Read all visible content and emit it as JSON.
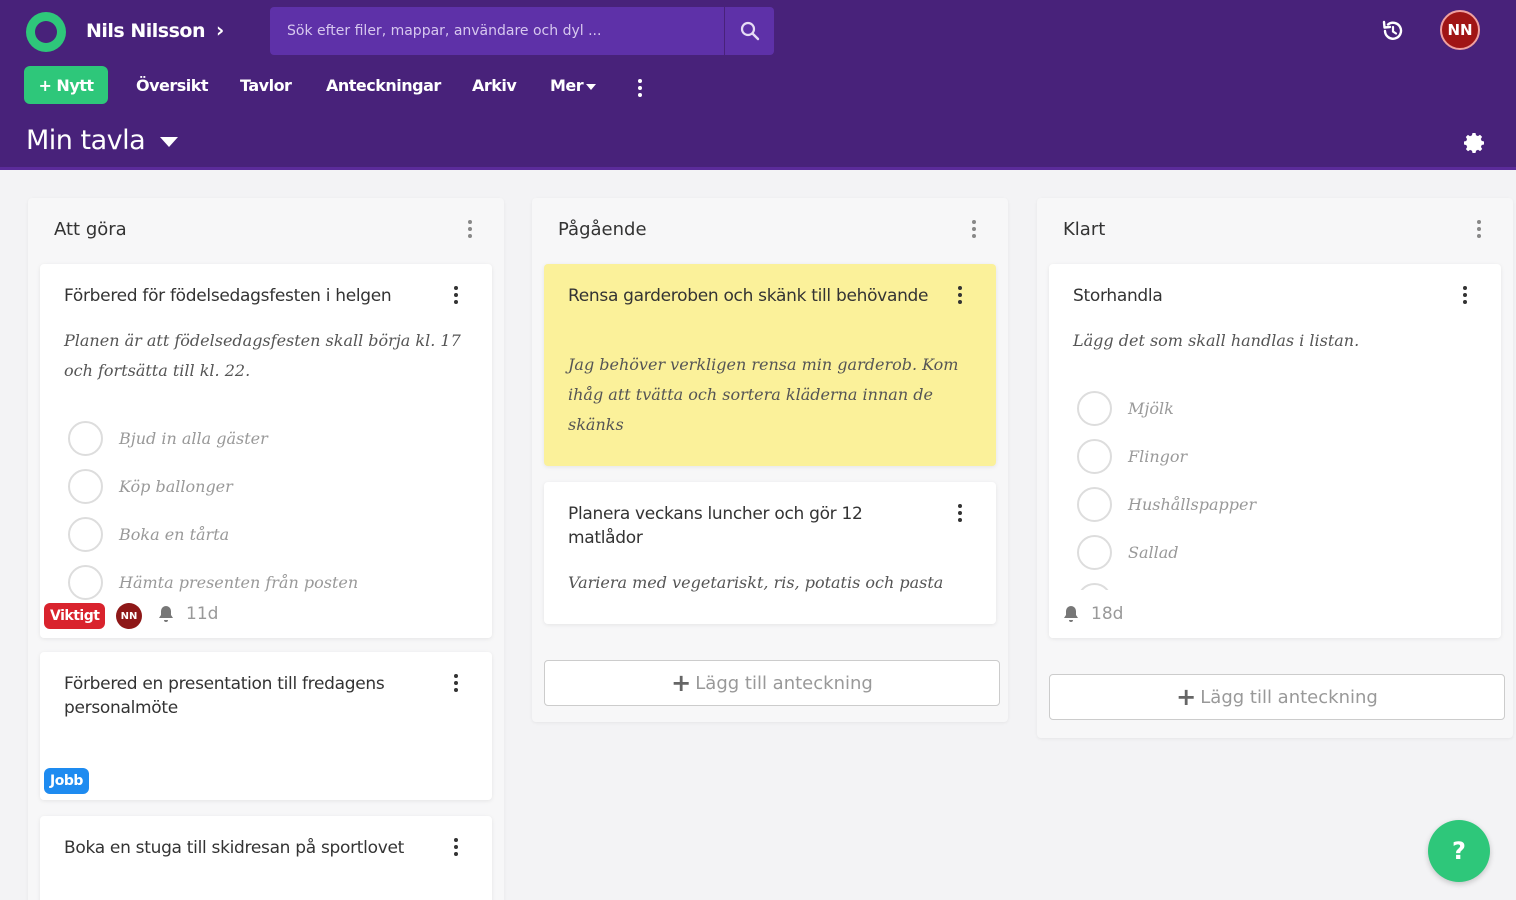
{
  "header": {
    "user_name": "Nils Nilsson",
    "search_placeholder": "Sök efter filer, mappar, användare och dyl ...",
    "avatar_initials": "NN",
    "board_title": "Min tavla"
  },
  "nav": {
    "new_label": "+ Nytt",
    "items": [
      "Översikt",
      "Tavlor",
      "Anteckningar",
      "Arkiv",
      "Mer"
    ]
  },
  "columns": [
    {
      "title": "Att göra",
      "cards": [
        {
          "title": "Förbered för födelsedagsfesten i helgen",
          "description": "Planen är att födelsedagsfesten skall börja kl. 17 och fortsätta till kl. 22.",
          "checklist": [
            "Bjud in alla gäster",
            "Köp ballonger",
            "Boka en tårta",
            "Hämta presenten från posten"
          ],
          "tag": "Viktigt",
          "avatar": "NN",
          "due": "11d"
        },
        {
          "title": "Förbered en presentation till fredagens personalmöte",
          "tag": "Jobb"
        },
        {
          "title": "Boka en stuga till skidresan på sportlovet"
        }
      ]
    },
    {
      "title": "Pågående",
      "cards": [
        {
          "title": "Rensa garderoben och skänk till behövande",
          "description": "Jag behöver verkligen rensa min garderob. Kom ihåg att tvätta och sortera kläderna innan de skänks"
        },
        {
          "title": "Planera veckans luncher och gör 12 matlådor",
          "description": "Variera med vegetariskt, ris, potatis och pasta"
        }
      ],
      "add_label": "Lägg till anteckning"
    },
    {
      "title": "Klart",
      "cards": [
        {
          "title": "Storhandla",
          "description": "Lägg det som skall handlas i listan.",
          "checklist": [
            "Mjölk",
            "Flingor",
            "Hushållspapper",
            "Sallad"
          ],
          "due": "18d"
        }
      ],
      "add_label": "Lägg till anteckning"
    }
  ],
  "help_label": "?",
  "colors": {
    "header_bg": "#48227a",
    "accent_green": "#2ec77a",
    "tag_red": "#d9232d",
    "tag_blue": "#1e8bf0",
    "note_yellow": "#fbf19a"
  }
}
